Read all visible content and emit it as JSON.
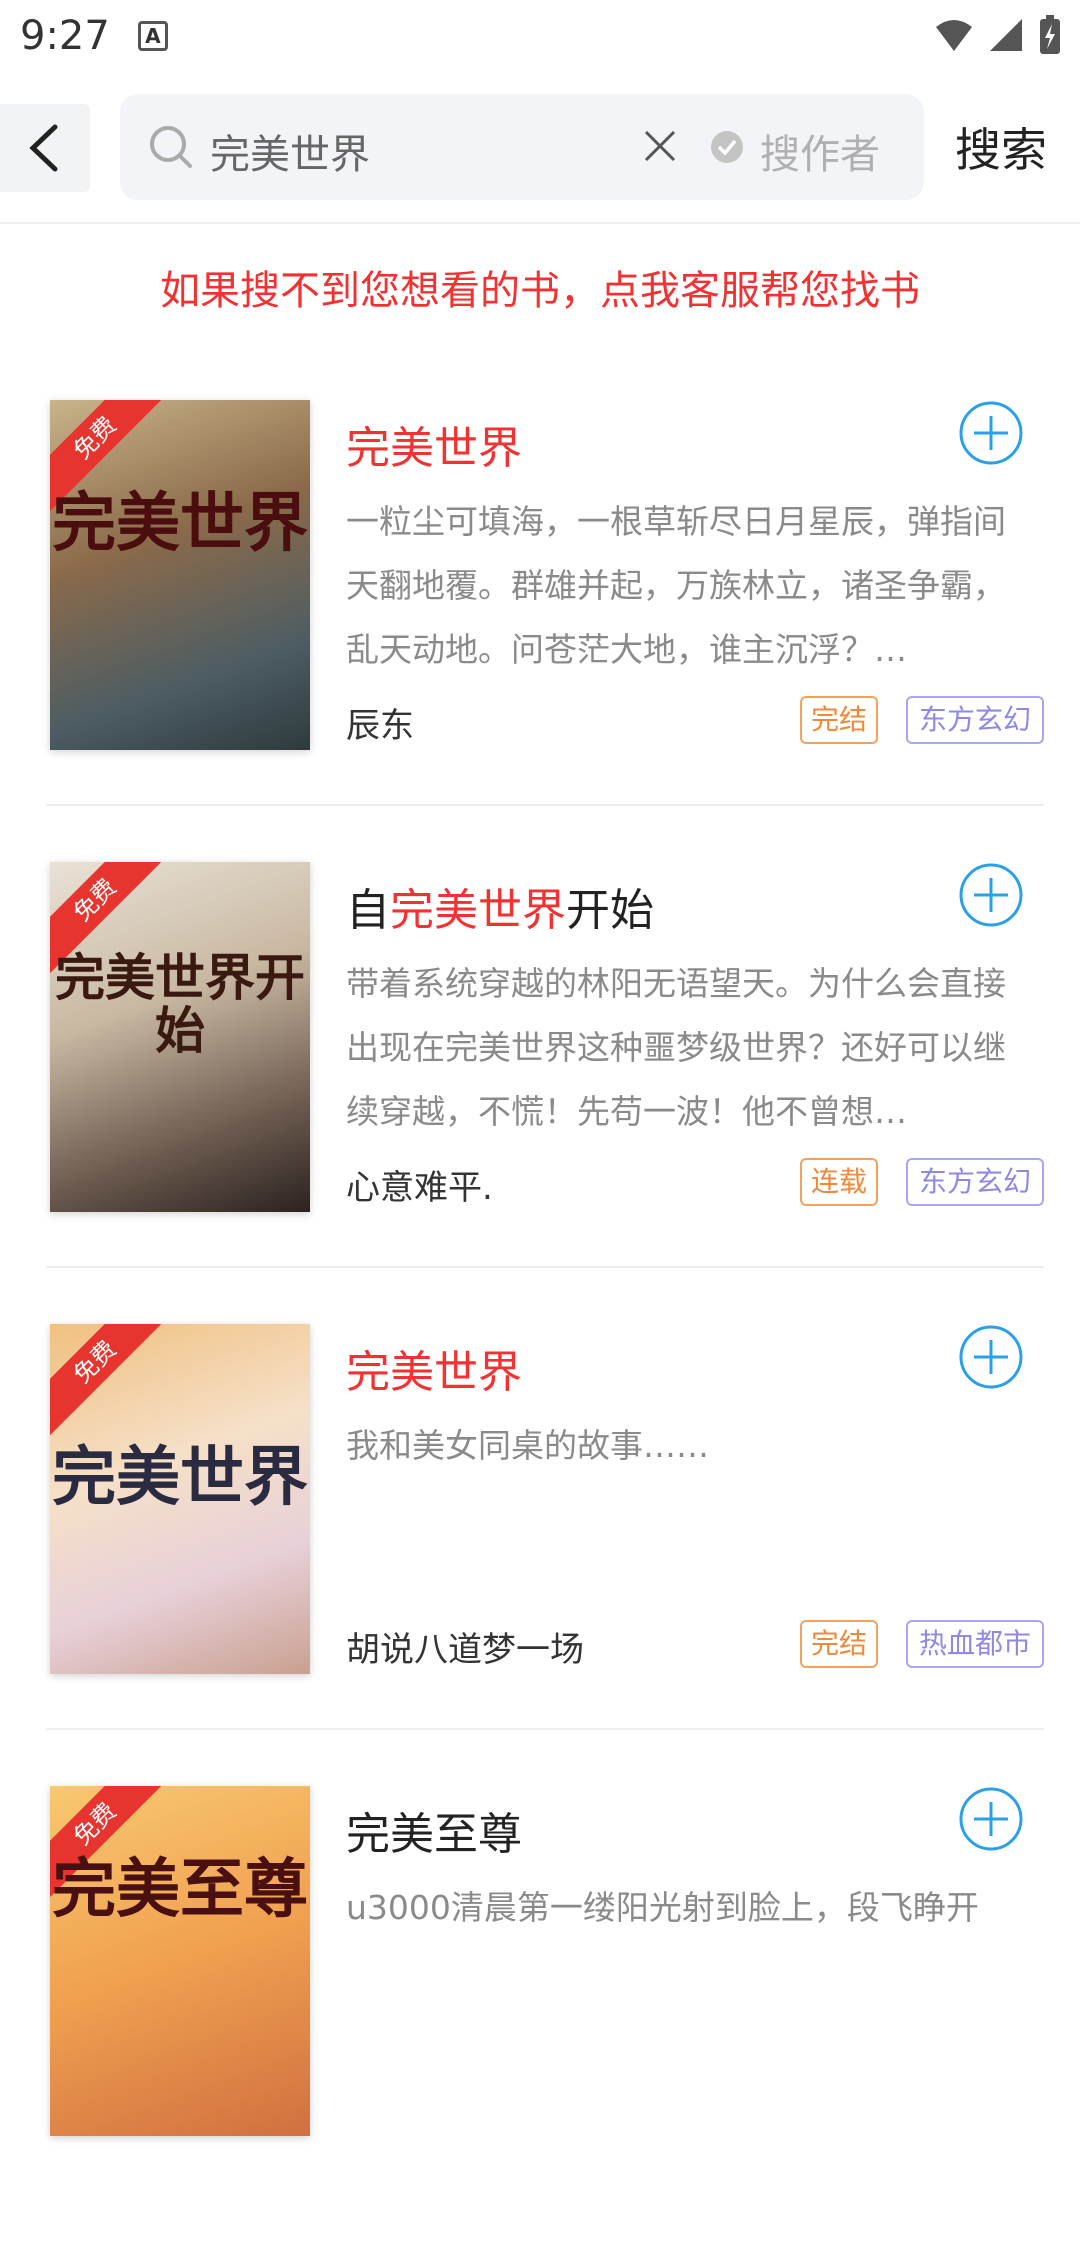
{
  "status_bar": {
    "time": "9:27",
    "notification_icon": "A"
  },
  "header": {
    "query": "完美世界",
    "by_author_label": "搜作者",
    "search_label": "搜索"
  },
  "help_text": "如果搜不到您想看的书，点我客服帮您找书",
  "books": [
    {
      "badge": "免费",
      "cover_text": "完美世界",
      "title_pre": "",
      "title_hl": "完美世界",
      "title_post": "",
      "description": "一粒尘可填海，一根草斩尽日月星辰，弹指间天翻地覆。群雄并起，万族林立，诸圣争霸，乱天动地。问苍茫大地，谁主沉浮？…",
      "author": "辰东",
      "status": "完结",
      "genre": "东方玄幻"
    },
    {
      "badge": "免费",
      "cover_text": "完美世界开始",
      "title_pre": "自",
      "title_hl": "完美世界",
      "title_post": "开始",
      "description": "带着系统穿越的林阳无语望天。为什么会直接出现在完美世界这种噩梦级世界？还好可以继续穿越，不慌！先苟一波！他不曾想…",
      "author": "心意难平.",
      "status": "连载",
      "genre": "东方玄幻"
    },
    {
      "badge": "免费",
      "cover_text": "完美世界",
      "title_pre": "",
      "title_hl": "完美世界",
      "title_post": "",
      "description": "我和美女同桌的故事……",
      "author": "胡说八道梦一场",
      "status": "完结",
      "genre": "热血都市"
    },
    {
      "badge": "免费",
      "cover_text": "完美至尊",
      "title_pre": "完美至尊",
      "title_hl": "",
      "title_post": "",
      "description": "u3000清晨第一缕阳光射到脸上，段飞睁开",
      "author": "",
      "status": "",
      "genre": ""
    }
  ],
  "colors": {
    "highlight": "#f23232",
    "accent_blue": "#2aa0e8",
    "status_tag": "#f08a3a",
    "genre_tag": "#8f89e6"
  }
}
